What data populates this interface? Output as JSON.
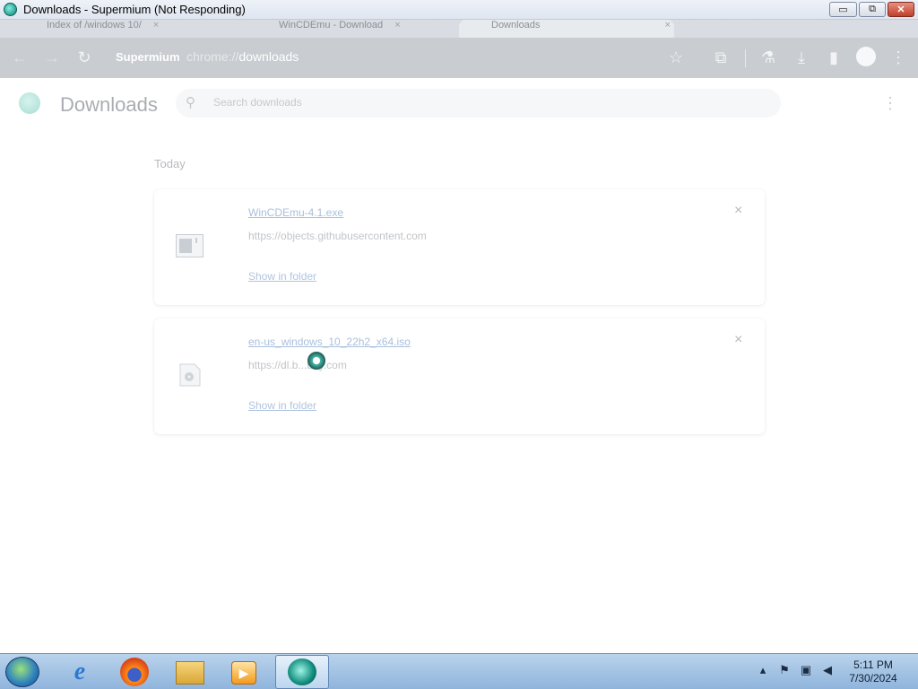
{
  "window": {
    "title": "Downloads - Supermium (Not Responding)",
    "controls": {
      "minimize": "▭",
      "maximize": "⧉",
      "close": "✕"
    }
  },
  "tabs": [
    {
      "label": "Index of /windows 10/",
      "active": false
    },
    {
      "label": "WinCDEmu - Download",
      "active": false
    },
    {
      "label": "Downloads",
      "active": true
    }
  ],
  "tab_close_glyph": "×",
  "toolbar": {
    "origin": "Supermium",
    "url_scheme": "chrome://",
    "url_path": "downloads",
    "icons": [
      "back-icon",
      "forward-icon",
      "reload-icon",
      "star-icon",
      "extensions-icon",
      "labs-icon",
      "download-icon",
      "sidepanel-icon",
      "profile-icon",
      "menu-icon"
    ]
  },
  "page": {
    "heading": "Downloads",
    "search": {
      "placeholder": "Search downloads",
      "value": ""
    },
    "section_label": "Today",
    "downloads": [
      {
        "filename": "WinCDEmu-4.1.exe",
        "source": "https://objects.githubusercontent.com",
        "action": "Show in folder",
        "remove": "×"
      },
      {
        "filename": "en-us_windows_10_22h2_x64.iso",
        "source": "https://dl.b...boy.com",
        "action": "Show in folder",
        "remove": "×"
      }
    ]
  },
  "taskbar": {
    "apps": [
      "internet-explorer",
      "firefox",
      "windows-explorer",
      "media-player",
      "supermium"
    ],
    "clock": {
      "time": "5:11 PM",
      "date": "7/30/2024"
    }
  }
}
